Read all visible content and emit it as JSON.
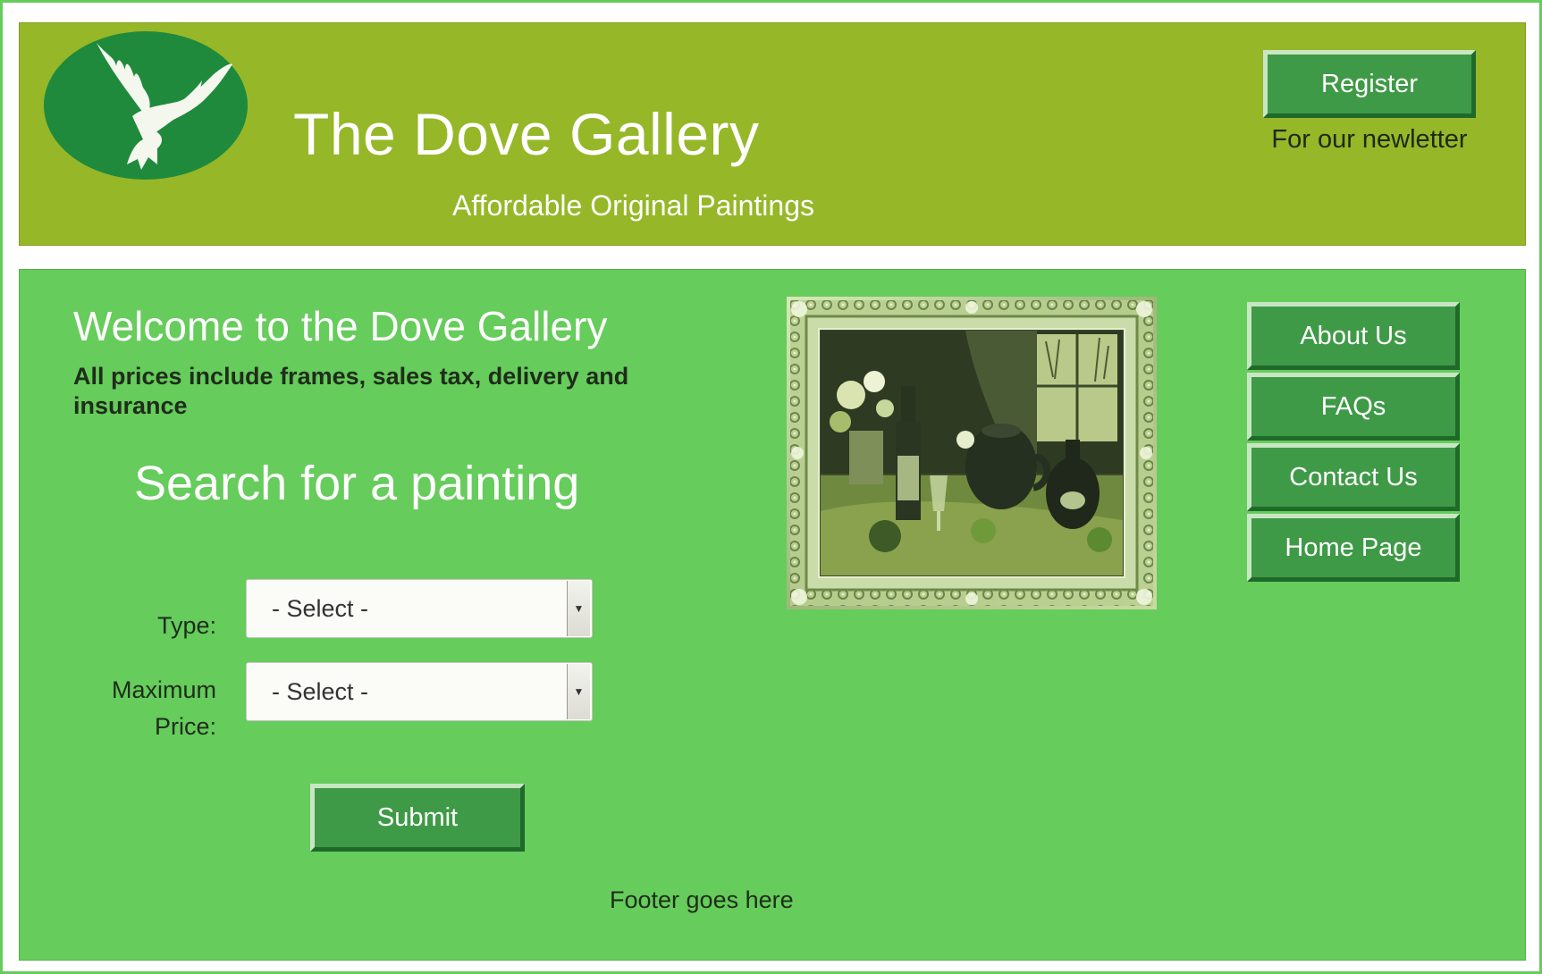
{
  "header": {
    "title": "The Dove Gallery",
    "tagline": "Affordable Original Paintings",
    "register_label": "Register",
    "register_caption": "For our newletter",
    "logo_icon": "dove-logo-icon"
  },
  "main": {
    "welcome_title": "Welcome to the Dove Gallery",
    "welcome_note": "All prices include frames, sales tax, delivery and insurance",
    "search_heading": "Search for a painting",
    "type_label": "Type:",
    "type_value": "- Select -",
    "price_label": "Maximum Price:",
    "price_value": "- Select -",
    "submit_label": "Submit",
    "footer": "Footer goes here",
    "painting_icon": "framed-painting-image"
  },
  "nav": {
    "items": [
      {
        "label": "About Us"
      },
      {
        "label": "FAQs"
      },
      {
        "label": "Contact Us"
      },
      {
        "label": "Home Page"
      }
    ]
  },
  "colors": {
    "header_bg": "#96b728",
    "main_bg": "#66cc5c",
    "button_bg": "#3f9a47",
    "logo_bg": "#1f8a3c"
  }
}
